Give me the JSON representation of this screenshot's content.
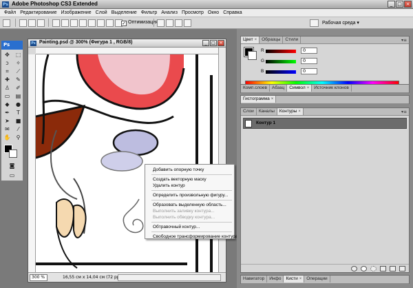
{
  "app": {
    "title": "Adobe Photoshop CS3 Extended",
    "ps_logo": "Ps"
  },
  "window_buttons": [
    "_",
    "□",
    "×"
  ],
  "menu": [
    "Файл",
    "Редактирование",
    "Изображение",
    "Слой",
    "Выделение",
    "Фильтр",
    "Анализ",
    "Просмотр",
    "Окно",
    "Справка"
  ],
  "options": {
    "autoselect_label": "Оптимизация",
    "workspace_label": "Рабочая среда ▾"
  },
  "document": {
    "title": "Painting.psd @ 300% (Фигура 1 , RGB/8)",
    "zoom": "300 %",
    "info": "16,55 см x 14,04 см (72 ppi)"
  },
  "context_menu": {
    "groups": [
      [
        "Добавить опорную точку"
      ],
      [
        "Создать векторную маску",
        "Удалить контур"
      ],
      [
        "Определить произвольную фигуру..."
      ],
      [
        "Образовать выделенную область...",
        "Выполнить заливку контура...",
        "Выполнить обводку контура..."
      ],
      [
        "Обтравочный контур..."
      ],
      [
        "Свободное трансформирование контура"
      ]
    ],
    "disabled": [
      "Выполнить заливку контура...",
      "Выполнить обводку контура..."
    ]
  },
  "panels": {
    "color": {
      "tabs": [
        "Цвет",
        "Образцы",
        "Стили"
      ],
      "sliders": [
        {
          "label": "R",
          "value": "0",
          "color_start": "#000000",
          "color_end": "#ff0000"
        },
        {
          "label": "G",
          "value": "0",
          "color_start": "#000000",
          "color_end": "#00ff00"
        },
        {
          "label": "B",
          "value": "0",
          "color_start": "#000000",
          "color_end": "#0000ff"
        }
      ]
    },
    "layer_comps": {
      "tabs": [
        "Комп.слоев",
        "Абзац",
        "Символ",
        "Источник клонов"
      ]
    },
    "histogram": {
      "tabs": [
        "Гистограмма"
      ]
    },
    "layers": {
      "tabs": [
        "Слои",
        "Каналы",
        "Контуры"
      ],
      "path_name": "Контур 1"
    },
    "navigator": {
      "tabs": [
        "Навигатор",
        "Инфо",
        "Кисти",
        "Операции"
      ]
    }
  },
  "colors": {
    "red": "#e8363a",
    "skin": "#f5d9b0",
    "brown": "#8b2a0a",
    "lavender": "#bdbde0",
    "title_blue": "#2a6fcf"
  }
}
